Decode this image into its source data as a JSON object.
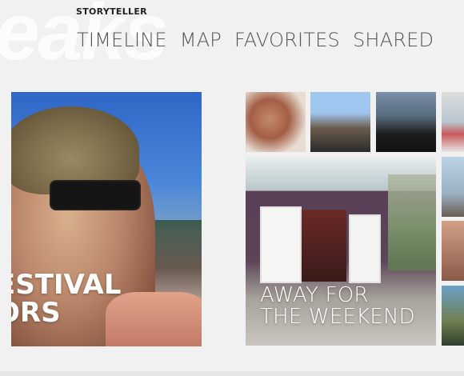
{
  "app": {
    "title": "STORYTELLER",
    "watermark": "eaks"
  },
  "nav": {
    "items": [
      "TIMELINE",
      "MAP",
      "FAVORITES",
      "SHARED"
    ]
  },
  "tiles": {
    "left": {
      "caption": "ESTIVAL\nORS"
    },
    "house": {
      "caption": "AWAY FOR\nTHE WEEKEND"
    }
  },
  "colors": {
    "background": "#f1f1f1",
    "nav_text": "#555555",
    "title_text": "#222222"
  }
}
